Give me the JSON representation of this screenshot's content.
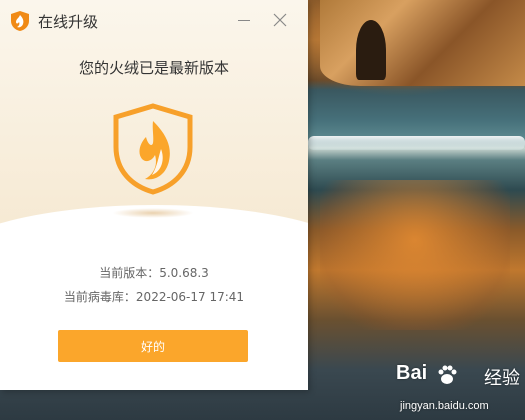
{
  "window": {
    "title": "在线升级",
    "logo_icon": "flame-shield-icon",
    "minimize_icon": "minimize-icon",
    "close_icon": "close-icon"
  },
  "main": {
    "headline": "您的火绒已是最新版本",
    "status_icon": "flame-shield-icon",
    "version_line": "当前版本：5.0.68.3",
    "virus_db_line": "当前病毒库：2022-06-17 17:41",
    "ok_button_label": "好的"
  },
  "colors": {
    "accent": "#fba62b",
    "header_bg": "#f6e9d2",
    "text_primary": "#333333",
    "text_secondary": "#666666"
  },
  "watermark": {
    "brand": "Bai",
    "brand_suffix": "经验",
    "domain": "jingyan.baidu.com"
  }
}
